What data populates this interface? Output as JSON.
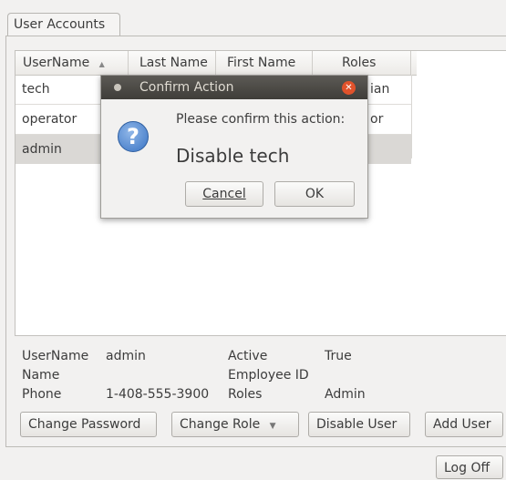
{
  "tab": {
    "label": "User Accounts"
  },
  "table": {
    "columns": [
      "UserName",
      "Last Name",
      "First Name",
      "Roles"
    ],
    "sort_indicator": "▲",
    "rows": [
      {
        "username": "tech",
        "roles_visible": "ian"
      },
      {
        "username": "operator",
        "roles_visible": "or"
      },
      {
        "username": "admin",
        "roles_visible": ""
      }
    ]
  },
  "details": {
    "username_label": "UserName",
    "username_value": "admin",
    "name_label": "Name",
    "phone_label": "Phone",
    "phone_value": "1-408-555-3900",
    "active_label": "Active",
    "active_value": "True",
    "employee_id_label": "Employee ID",
    "roles_label": "Roles",
    "roles_value": "Admin"
  },
  "buttons": {
    "change_password": "Change Password",
    "change_role": "Change Role",
    "disable_user": "Disable User",
    "add_user": "Add User",
    "log_off": "Log Off"
  },
  "dialog": {
    "title": "Confirm Action",
    "message": "Please confirm this action:",
    "action": "Disable tech",
    "cancel_label": "Cancel",
    "ok_label": "OK"
  },
  "colors": {
    "dialog_title_bg": "#4a4843",
    "close_button": "#e0522b",
    "selected_row": "#dad8d5"
  }
}
